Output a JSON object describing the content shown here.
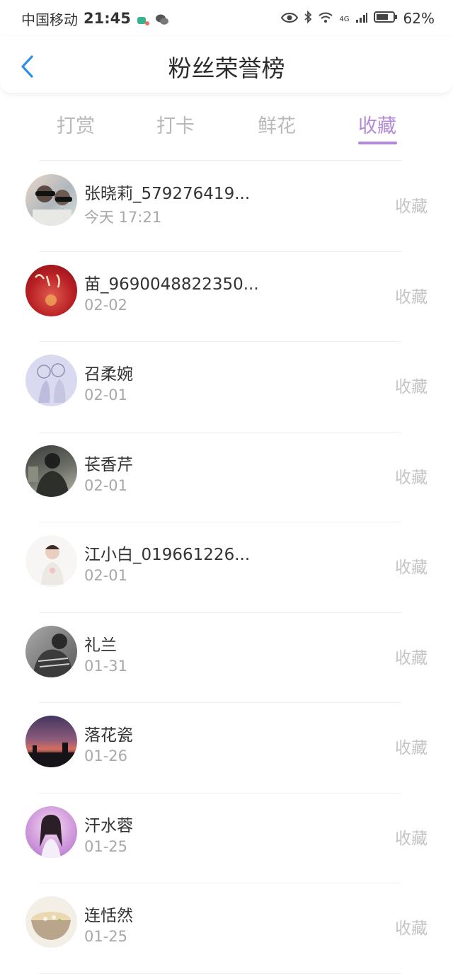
{
  "status": {
    "carrier": "中国移动",
    "time": "21:45",
    "network": "4G",
    "battery": "62%"
  },
  "header": {
    "title": "粉丝荣誉榜"
  },
  "tabs": [
    {
      "label": "打赏"
    },
    {
      "label": "打卡"
    },
    {
      "label": "鲜花"
    },
    {
      "label": "收藏",
      "active": true
    }
  ],
  "colors": {
    "accent": "#b48ad7",
    "back_arrow": "#2f8fe6"
  },
  "fans": [
    {
      "name": "张晓莉_579276419...",
      "date": "今天 17:21",
      "action": "收藏"
    },
    {
      "name": "苗_9690048822350...",
      "date": "02-02",
      "action": "收藏"
    },
    {
      "name": "召柔婉",
      "date": "02-01",
      "action": "收藏"
    },
    {
      "name": "苌香芹",
      "date": "02-01",
      "action": "收藏"
    },
    {
      "name": "江小白_019661226...",
      "date": "02-01",
      "action": "收藏"
    },
    {
      "name": "礼兰",
      "date": "01-31",
      "action": "收藏"
    },
    {
      "name": "落花瓷",
      "date": "01-26",
      "action": "收藏"
    },
    {
      "name": "汗水蓉",
      "date": "01-25",
      "action": "收藏"
    },
    {
      "name": "连恬然",
      "date": "01-25",
      "action": "收藏"
    }
  ]
}
